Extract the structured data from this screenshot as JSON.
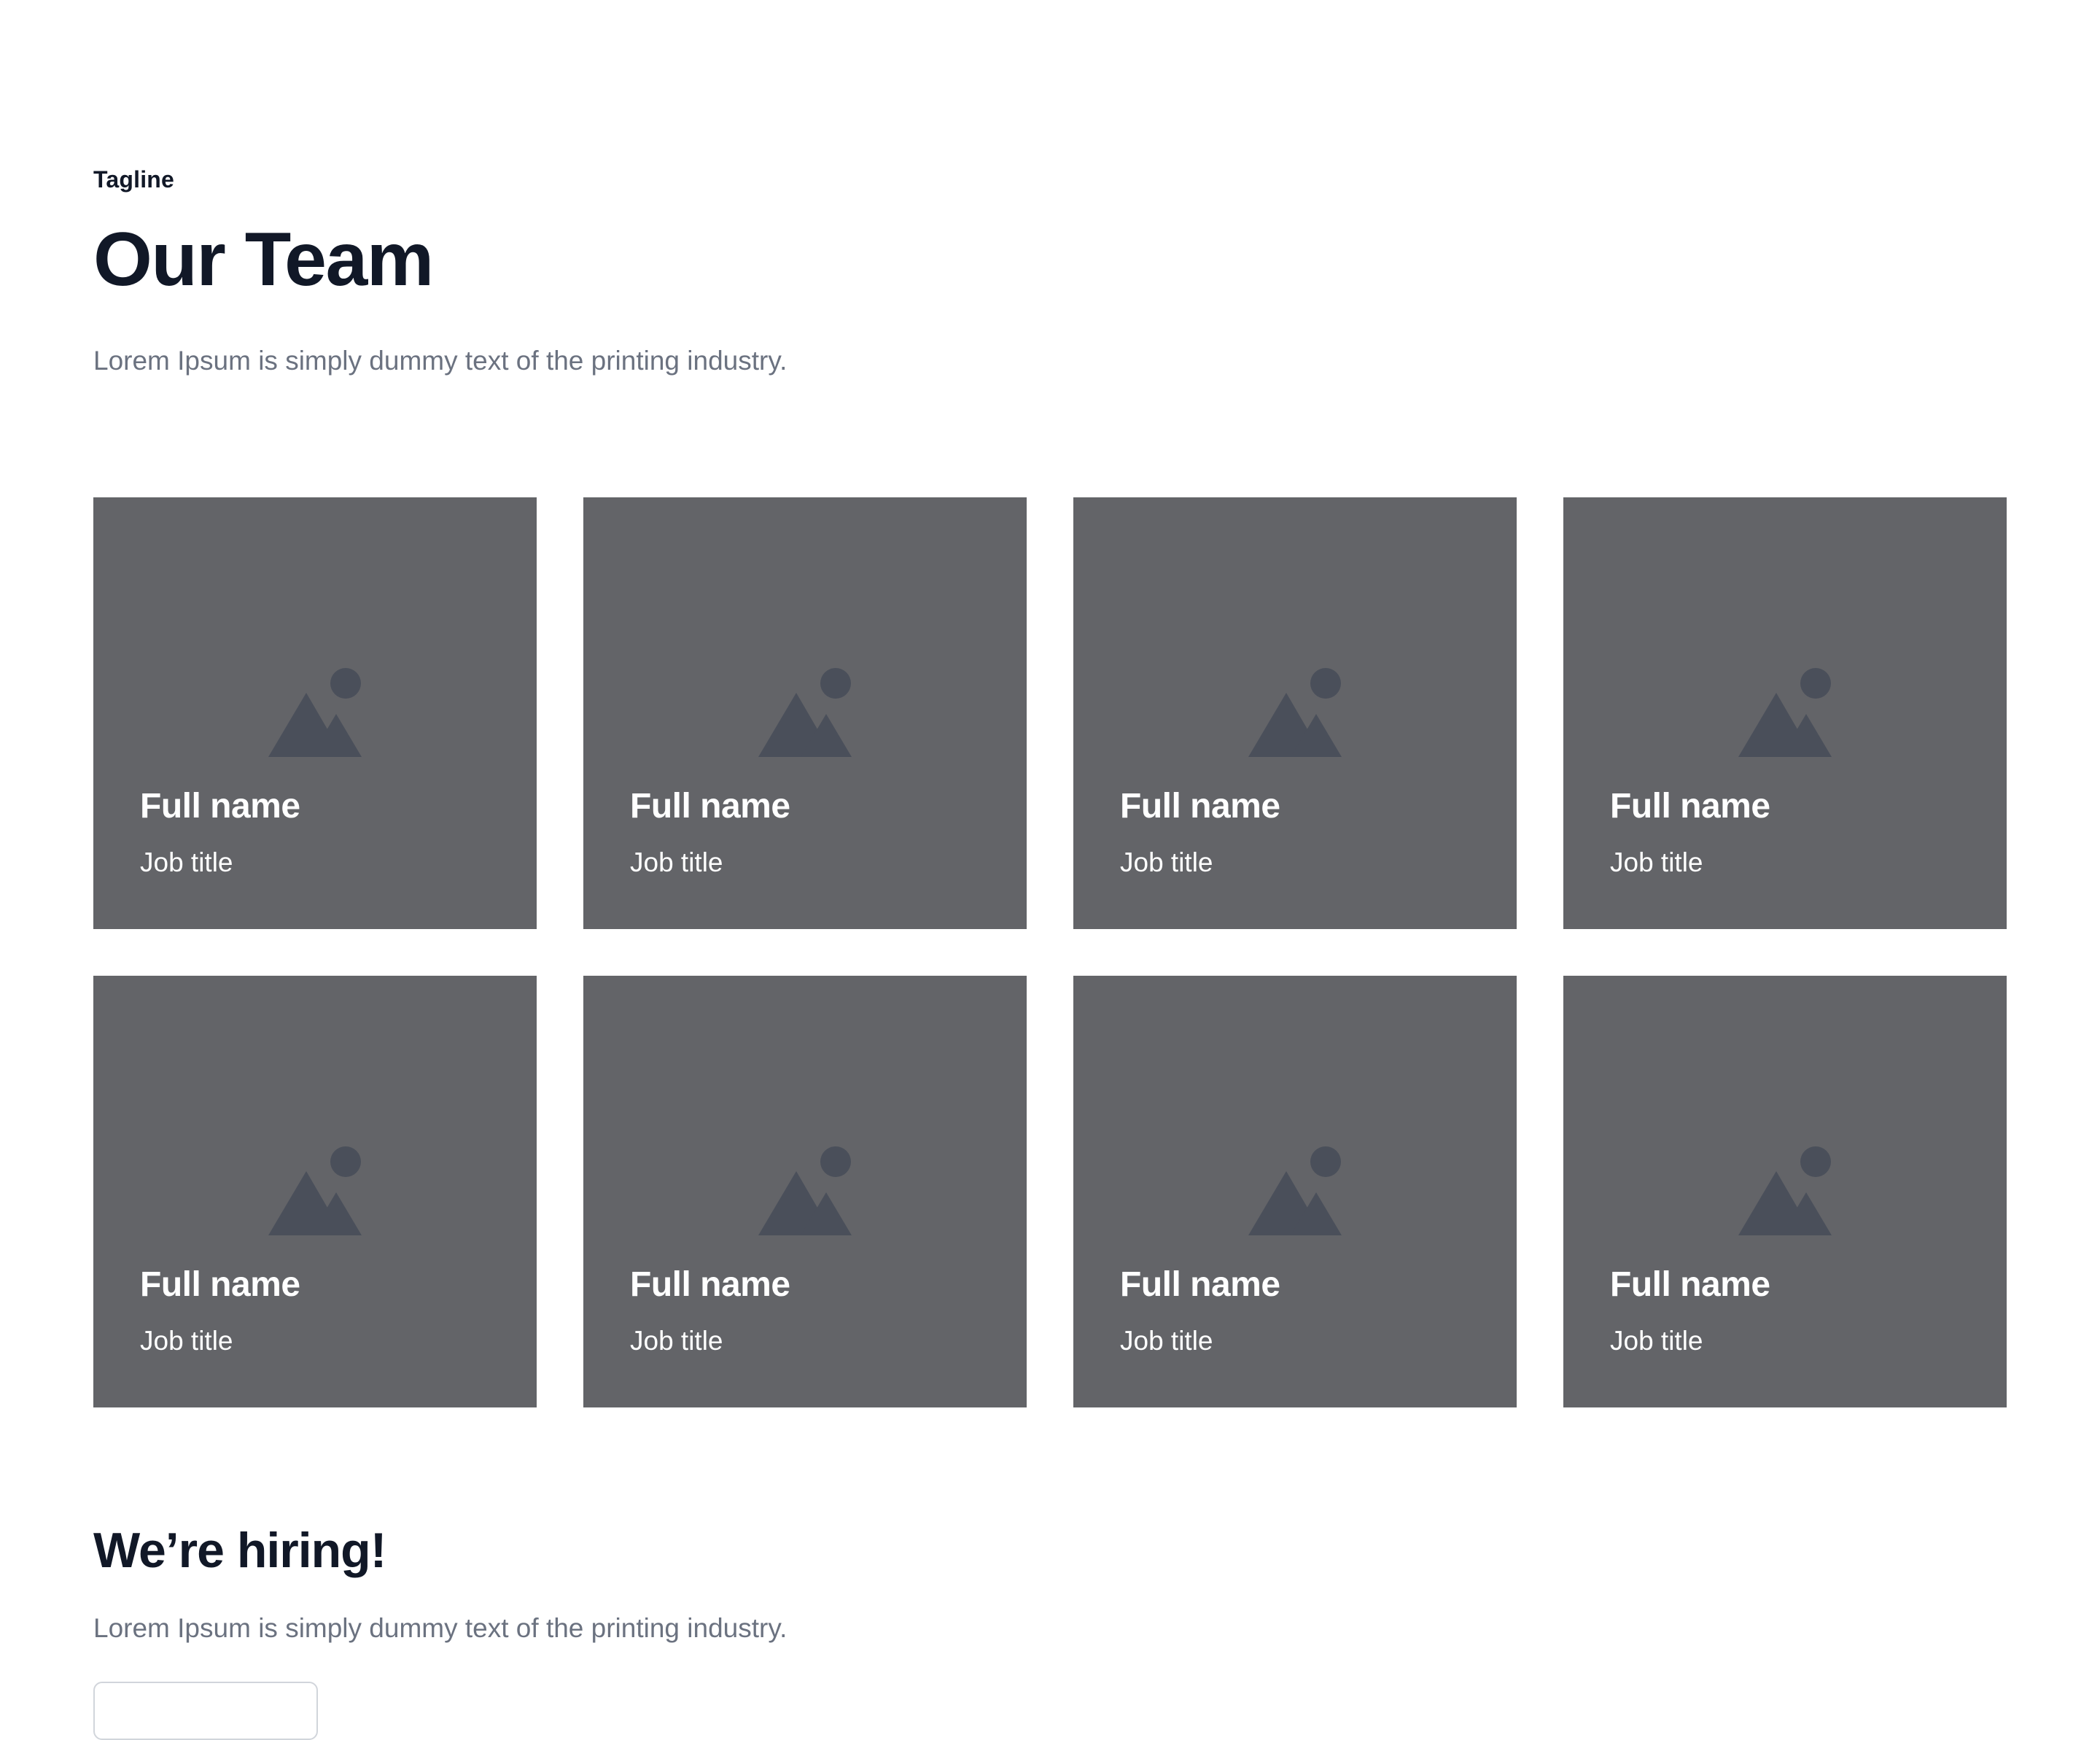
{
  "header": {
    "tagline": "Tagline",
    "title": "Our Team",
    "subtitle": "Lorem Ipsum is simply dummy text of the printing industry."
  },
  "team": [
    {
      "name": "Full name",
      "job": "Job title"
    },
    {
      "name": "Full name",
      "job": "Job title"
    },
    {
      "name": "Full name",
      "job": "Job title"
    },
    {
      "name": "Full name",
      "job": "Job title"
    },
    {
      "name": "Full name",
      "job": "Job title"
    },
    {
      "name": "Full name",
      "job": "Job title"
    },
    {
      "name": "Full name",
      "job": "Job title"
    },
    {
      "name": "Full name",
      "job": "Job title"
    }
  ],
  "hiring": {
    "title": "We’re hiring!",
    "text": "Lorem Ipsum is simply dummy text of the printing industry."
  },
  "icons": {
    "card_image": "image-placeholder-icon"
  },
  "colors": {
    "card_background": "#636468",
    "icon": "#4a4f5a",
    "heading": "#111827",
    "muted_text": "#6b7280"
  }
}
